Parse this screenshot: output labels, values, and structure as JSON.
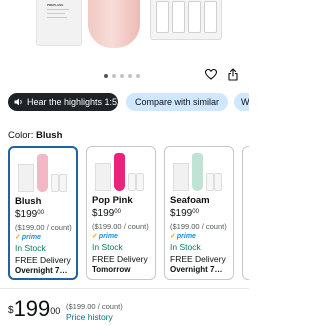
{
  "hero": {
    "left_product_tag": "PREPLASH",
    "dots": {
      "count": 5,
      "active_index": 0
    }
  },
  "actions": {
    "favorite_icon": "heart-icon",
    "share_icon": "share-icon"
  },
  "pills": {
    "listen": "Hear the highlights 1:52",
    "compare": "Compare with similar",
    "what": "Wha"
  },
  "color": {
    "label": "Color:",
    "selected": "Blush"
  },
  "cards": [
    {
      "name": "Blush",
      "price_dollars": "$199",
      "price_cents": "00",
      "unit": "($199.00 / count)",
      "prime": "prime",
      "stock": "In Stock",
      "delivery": "FREE Delivery",
      "speed": "Overnight 7…",
      "accent": "#f2b8c6",
      "selected": true
    },
    {
      "name": "Pop Pink",
      "price_dollars": "$199",
      "price_cents": "00",
      "unit": "($199.00 / count)",
      "prime": "prime",
      "stock": "In Stock",
      "delivery": "FREE Delivery",
      "speed": "Tomorrow",
      "accent": "#e8257a",
      "selected": false
    },
    {
      "name": "Seafoam",
      "price_dollars": "$199",
      "price_cents": "00",
      "unit": "($199.00 / count)",
      "prime": "prime",
      "stock": "In Stock",
      "delivery": "FREE Delivery",
      "speed": "Overnight 7…",
      "accent": "#bfe3d4",
      "selected": false
    }
  ],
  "footer": {
    "currency": "$",
    "dollars": "199",
    "cents": "00",
    "unit": "($199.00 / count)",
    "history": "Price history"
  },
  "colors": {
    "link": "#007185",
    "selected_border": "#2162a1",
    "pill_blue": "#cfe7ff",
    "stock_green": "#067d62",
    "prime_blue": "#1a8fe2"
  }
}
